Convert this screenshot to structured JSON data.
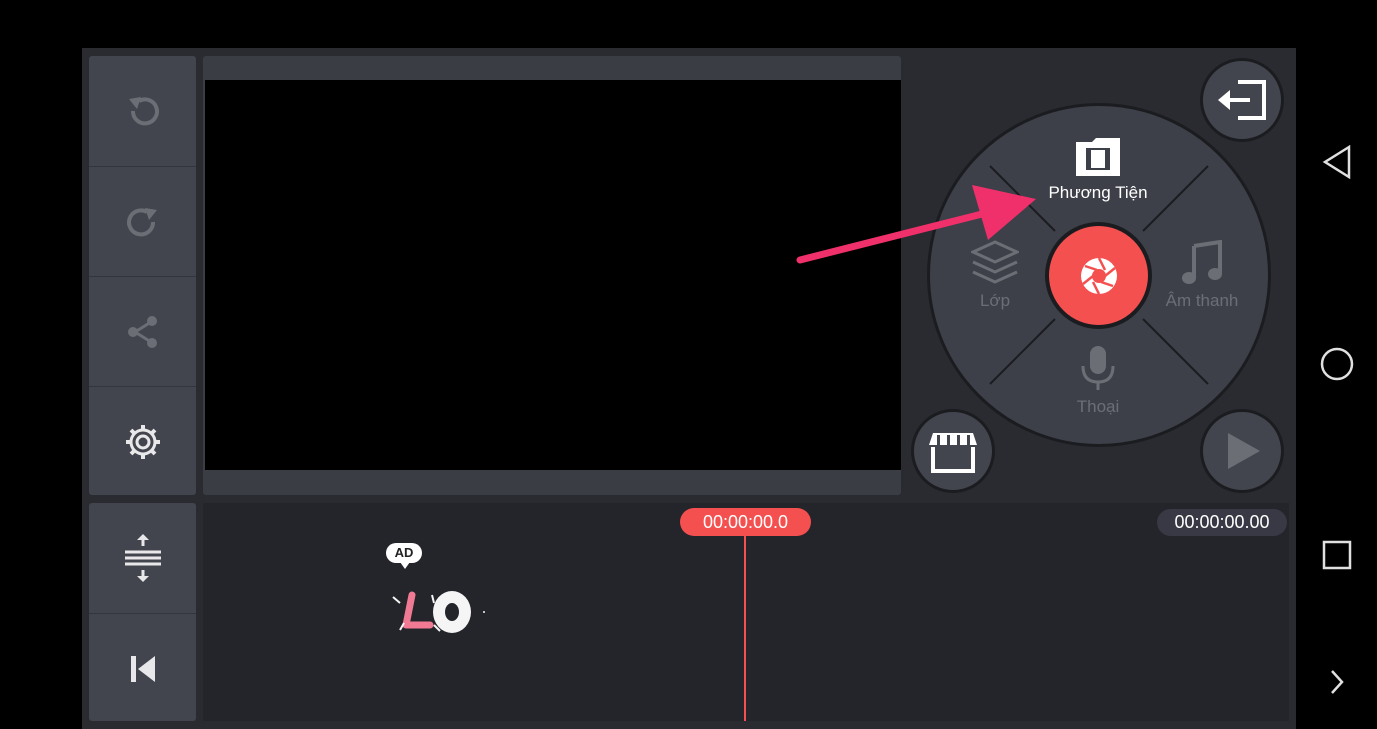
{
  "left_tools": [
    {
      "icon": "undo-icon"
    },
    {
      "icon": "redo-icon"
    },
    {
      "icon": "share-icon"
    },
    {
      "icon": "settings-gear-icon"
    }
  ],
  "left_tools_bottom": [
    {
      "icon": "expand-timeline-icon"
    },
    {
      "icon": "skip-to-start-icon"
    }
  ],
  "dial": {
    "media_label": "Phương Tiện",
    "layer_label": "Lớp",
    "audio_label": "Âm thanh",
    "voice_label": "Thoại"
  },
  "timeline": {
    "current_time": "00:00:00.0",
    "total_time": "00:00:00.00",
    "ad_badge": "AD"
  },
  "colors": {
    "accent": "#f4504f",
    "annotation_arrow": "#f0306a",
    "panel": "#43454e",
    "background": "#2a2b31"
  }
}
